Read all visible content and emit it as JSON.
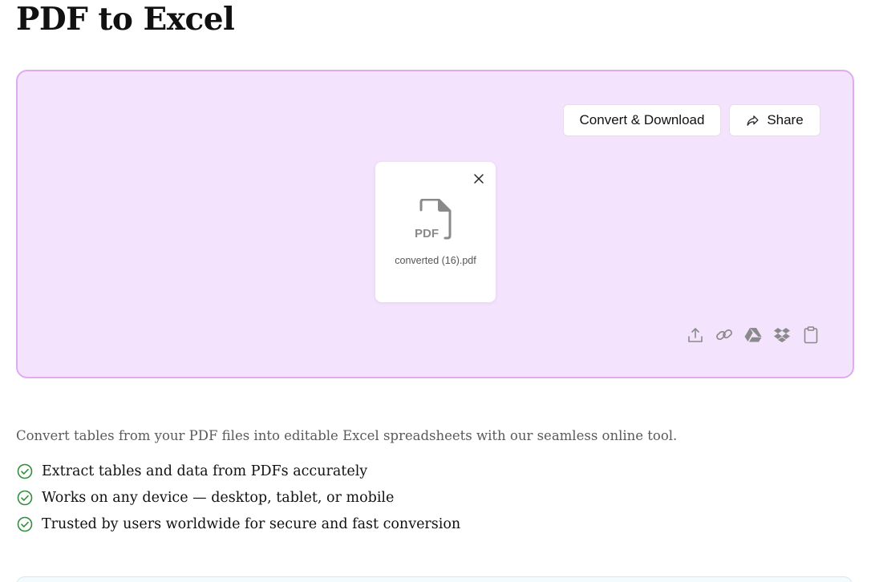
{
  "page": {
    "title": "PDF to Excel"
  },
  "toolbar": {
    "convert_label": "Convert & Download",
    "share_label": "Share",
    "share_icon": "share-arrow-icon"
  },
  "file": {
    "name": "converted (16).pdf",
    "type_label": "PDF",
    "icon": "pdf-file-icon",
    "remove_icon": "close-icon"
  },
  "sources": [
    {
      "icon": "upload-icon"
    },
    {
      "icon": "link-icon"
    },
    {
      "icon": "google-drive-icon"
    },
    {
      "icon": "dropbox-icon"
    },
    {
      "icon": "clipboard-icon"
    }
  ],
  "description": "Convert tables from your PDF files into editable Excel spreadsheets with our seamless online tool.",
  "features": [
    {
      "text": "Extract tables and data from PDFs accurately",
      "icon": "check-circle-icon"
    },
    {
      "text": "Works on any device — desktop, tablet, or mobile",
      "icon": "check-circle-icon"
    },
    {
      "text": "Trusted by users worldwide for secure and fast conversion",
      "icon": "check-circle-icon"
    }
  ],
  "colors": {
    "dropzone_bg": "#f3e3fd",
    "dropzone_border": "#e0aaf5",
    "check_green": "#2f8f3a",
    "icon_gray": "#8a8a8a"
  }
}
